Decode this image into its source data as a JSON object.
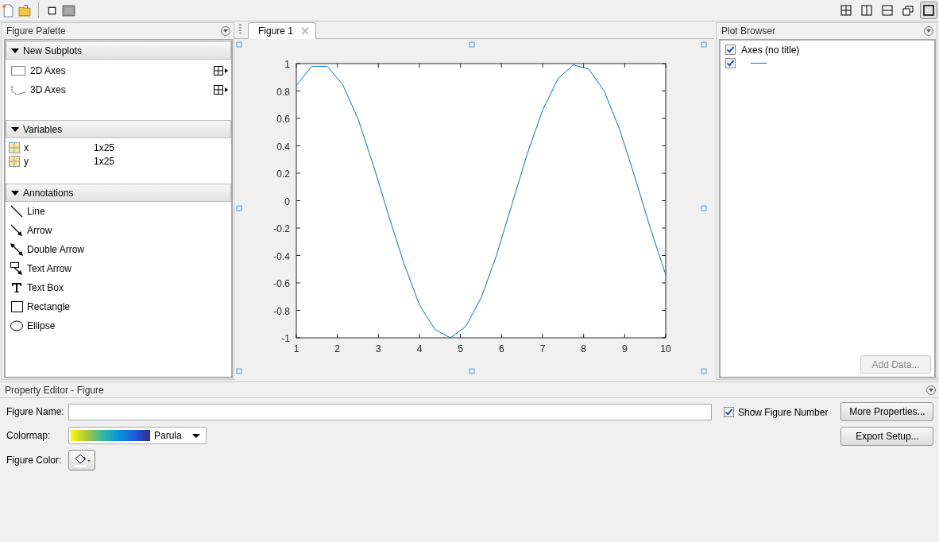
{
  "toolbar": {
    "layout_buttons": [
      {
        "kind": "grid",
        "selected": false
      },
      {
        "kind": "columns",
        "selected": false
      },
      {
        "kind": "rows",
        "selected": false
      },
      {
        "kind": "undock",
        "selected": false
      },
      {
        "kind": "single",
        "selected": true
      }
    ]
  },
  "figure_palette": {
    "title": "Figure Palette",
    "sections": [
      {
        "title": "New Subplots",
        "expanded": true,
        "kind": "subplots",
        "items": [
          {
            "label": "2D Axes",
            "kind": "flat"
          },
          {
            "label": "3D Axes",
            "kind": "spatial"
          }
        ]
      },
      {
        "title": "Variables",
        "expanded": true,
        "kind": "variables",
        "items": [
          {
            "name": "x",
            "size": "1x25"
          },
          {
            "name": "y",
            "size": "1x25"
          }
        ]
      },
      {
        "title": "Annotations",
        "expanded": true,
        "kind": "annotations",
        "items": [
          {
            "label": "Line",
            "kind": "line"
          },
          {
            "label": "Arrow",
            "kind": "arrow"
          },
          {
            "label": "Double Arrow",
            "kind": "double-arrow"
          },
          {
            "label": "Text Arrow",
            "kind": "text-arrow"
          },
          {
            "label": "Text Box",
            "kind": "text-box"
          },
          {
            "label": "Rectangle",
            "kind": "rectangle"
          },
          {
            "label": "Ellipse",
            "kind": "ellipse"
          }
        ]
      }
    ]
  },
  "tabs": [
    {
      "label": "Figure 1",
      "selected": true
    }
  ],
  "figure": {
    "chart_data": {
      "type": "line",
      "x": [
        1,
        1.375,
        1.75,
        2.125,
        2.5,
        2.875,
        3.25,
        3.625,
        4,
        4.375,
        4.75,
        5.125,
        5.5,
        5.875,
        6.25,
        6.625,
        7,
        7.375,
        7.75,
        8.125,
        8.5,
        8.875,
        9.25,
        9.625,
        10
      ],
      "series": [
        {
          "color": "#0072bd",
          "values": [
            0.84,
            0.98,
            0.98,
            0.85,
            0.6,
            0.26,
            -0.11,
            -0.46,
            -0.76,
            -0.94,
            -1.0,
            -0.92,
            -0.71,
            -0.4,
            -0.03,
            0.34,
            0.66,
            0.89,
            0.99,
            0.96,
            0.8,
            0.52,
            0.17,
            -0.2,
            -0.54
          ]
        }
      ],
      "xlim": [
        1,
        10
      ],
      "ylim": [
        -1,
        1
      ],
      "xticks": [
        1,
        2,
        3,
        4,
        5,
        6,
        7,
        8,
        9,
        10
      ],
      "yticks": [
        -1,
        -0.8,
        -0.6,
        -0.4,
        -0.2,
        0,
        0.2,
        0.4,
        0.6,
        0.8,
        1
      ]
    }
  },
  "plot_browser": {
    "title": "Plot Browser",
    "items": [
      {
        "kind": "axes",
        "label": "Axes (no title)",
        "checked": true
      },
      {
        "kind": "line",
        "checked": true,
        "color": "#0072bd"
      }
    ],
    "add_data_button": {
      "label": "Add Data...",
      "disabled": true
    }
  },
  "property_editor": {
    "title": "Property Editor - Figure",
    "figure_name": {
      "label": "Figure Name:"
    },
    "colormap": {
      "label": "Colormap:",
      "value": "Parula"
    },
    "figure_color": {
      "label": "Figure Color:"
    },
    "show_figure_number": {
      "label": "Show Figure Number",
      "checked": true
    },
    "buttons": [
      {
        "label": "More Properties..."
      },
      {
        "label": "Export Setup..."
      }
    ]
  }
}
